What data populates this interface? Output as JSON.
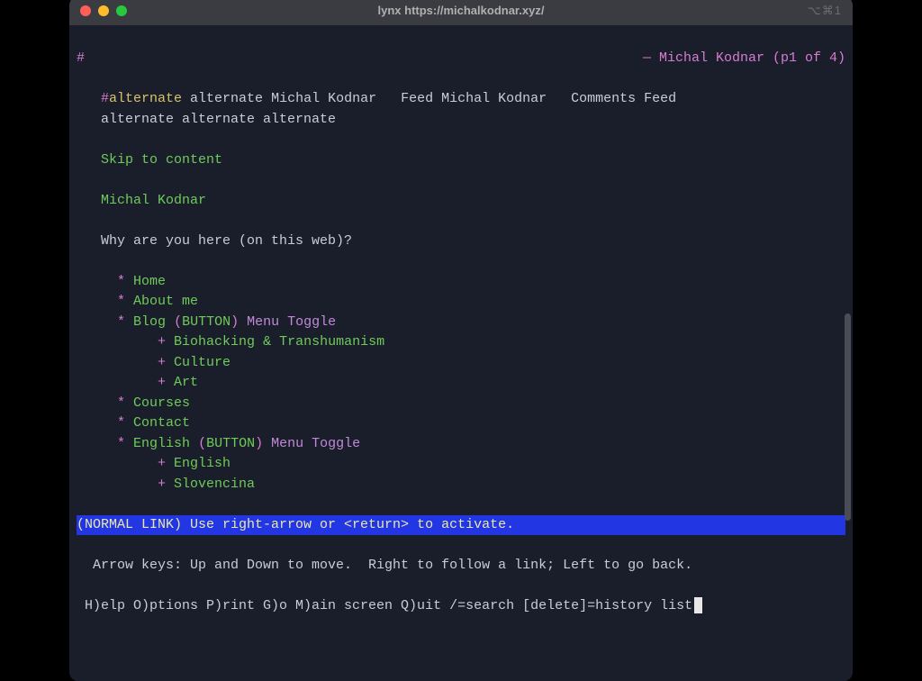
{
  "window": {
    "title": "lynx https://michalkodnar.xyz/",
    "shortcut": "⌥⌘1"
  },
  "header": {
    "hash": "#",
    "page_indicator": "— Michal Kodnar (p1 of 4)"
  },
  "meta": {
    "hash": "#",
    "alternate1": "alternate",
    "rest1": " alternate Michal Kodnar   Feed Michal Kodnar   Comments Feed",
    "rest2": "alternate alternate alternate"
  },
  "links": {
    "skip": "Skip to content",
    "site_title": "Michal Kodnar"
  },
  "tagline": "Why are you here (on this web)?",
  "nav": {
    "bullet": "*",
    "subbullet": "+",
    "home": "Home",
    "about": "About me",
    "blog": "Blog",
    "button_label": "BUTTON",
    "menu_toggle": "Menu Toggle",
    "sub_bio": "Biohacking & Transhumanism",
    "sub_culture": "Culture",
    "sub_art": "Art",
    "courses": "Courses",
    "contact": "Contact",
    "english": "English",
    "sub_english": "English",
    "sub_slovencina": "Slovencina"
  },
  "status": "(NORMAL LINK) Use right-arrow or <return> to activate.",
  "footer": {
    "line1": "  Arrow keys: Up and Down to move.  Right to follow a link; Left to go back.",
    "line2": " H)elp O)ptions P)rint G)o M)ain screen Q)uit /=search [delete]=history list"
  }
}
